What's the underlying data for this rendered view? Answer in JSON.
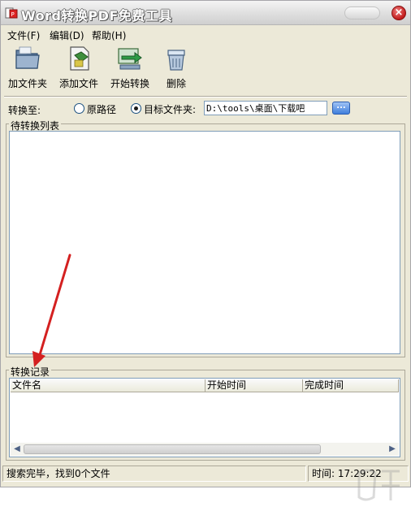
{
  "window": {
    "title": "Word转换PDF免费工具",
    "close_glyph": "×"
  },
  "menu": [
    {
      "label": "文件(F)"
    },
    {
      "label": "编辑(D)"
    },
    {
      "label": "帮助(H)"
    }
  ],
  "toolbar": [
    {
      "label": "加文件夹",
      "icon": "folder-icon"
    },
    {
      "label": "添加文件",
      "icon": "add-file-icon"
    },
    {
      "label": "开始转换",
      "icon": "convert-icon"
    },
    {
      "label": "删除",
      "icon": "delete-icon"
    }
  ],
  "convert_to": {
    "label": "转换至:",
    "option_original": "原路径",
    "option_target": "目标文件夹:",
    "selected": "target",
    "path_value": "D:\\tools\\桌面\\下载吧",
    "browse_label": "..."
  },
  "pending": {
    "title": "待转换列表"
  },
  "records": {
    "title": "转换记录",
    "columns": [
      "文件名",
      "开始时间",
      "完成时间"
    ],
    "rows": []
  },
  "status": {
    "message": "搜索完毕，找到0个文件",
    "time_label": "时间:",
    "time_value": "17:29:22"
  },
  "colors": {
    "window_bg": "#ece9d8",
    "annotation_arrow": "#d42020"
  }
}
